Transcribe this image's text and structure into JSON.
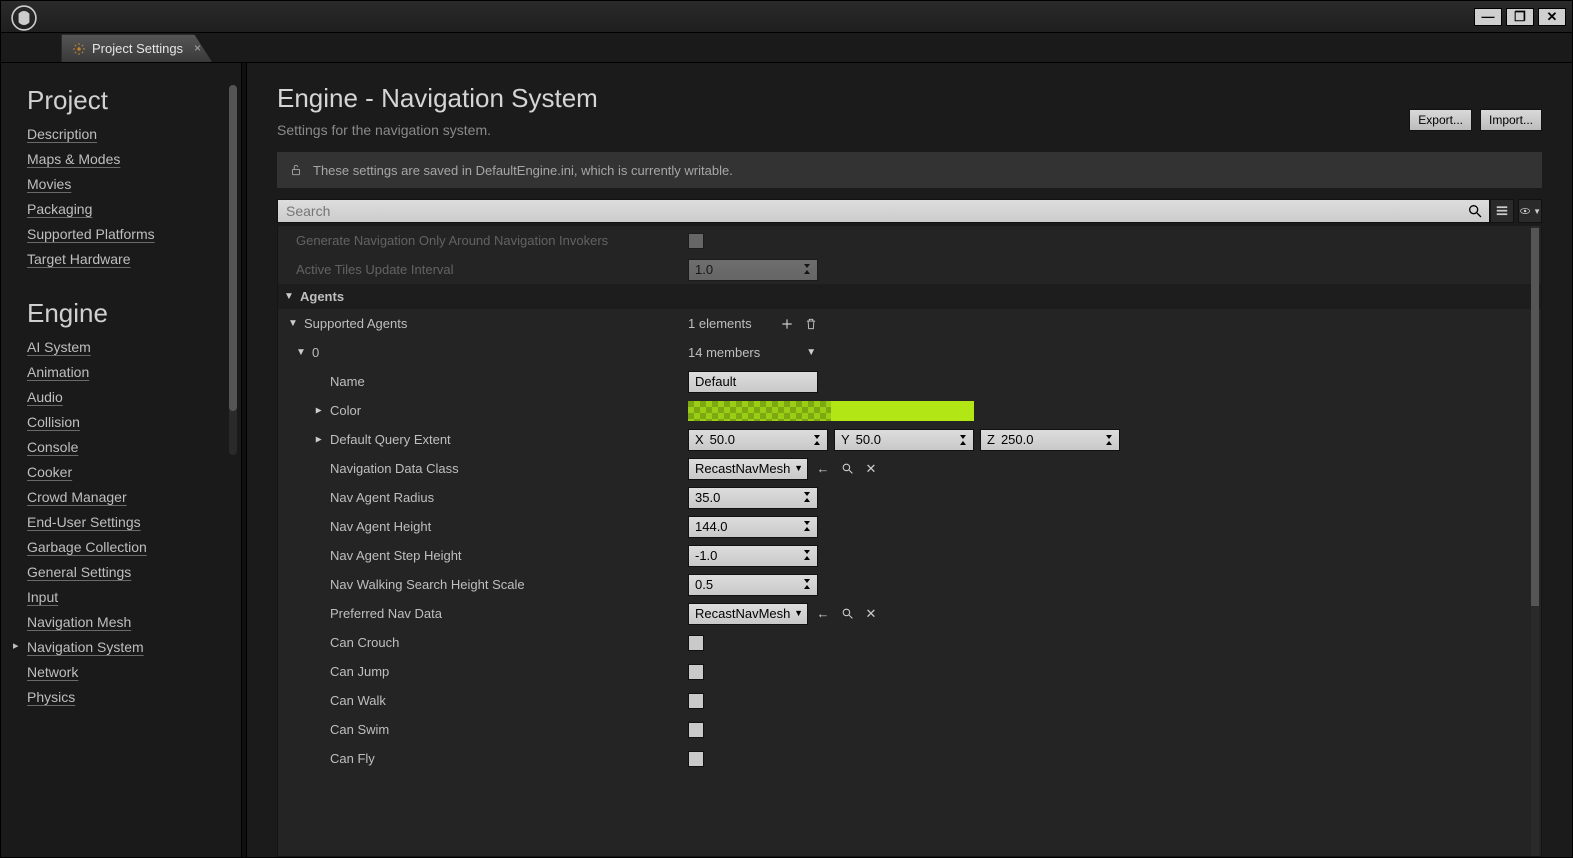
{
  "tab": {
    "title": "Project Settings",
    "close": "×"
  },
  "win": {
    "min": "—",
    "max": "❐",
    "close": "✕"
  },
  "sidebar": {
    "sections": [
      {
        "title": "Project",
        "items": [
          "Description",
          "Maps & Modes",
          "Movies",
          "Packaging",
          "Supported Platforms",
          "Target Hardware"
        ]
      },
      {
        "title": "Engine",
        "items": [
          "AI System",
          "Animation",
          "Audio",
          "Collision",
          "Console",
          "Cooker",
          "Crowd Manager",
          "End-User Settings",
          "Garbage Collection",
          "General Settings",
          "Input",
          "Navigation Mesh",
          "Navigation System",
          "Network",
          "Physics"
        ]
      }
    ],
    "selected": "Navigation System"
  },
  "page": {
    "title": "Engine - Navigation System",
    "subtitle": "Settings for the navigation system.",
    "export": "Export...",
    "import": "Import..."
  },
  "banner": "These settings are saved in DefaultEngine.ini, which is currently writable.",
  "search": {
    "placeholder": "Search"
  },
  "props": {
    "partial_rows": {
      "gen_nav_label": "Generate Navigation Only Around Navigation Invokers",
      "tiles_label": "Active Tiles Update Interval",
      "tiles_value": "1.0"
    },
    "agents_header": "Agents",
    "supported_agents": {
      "label": "Supported Agents",
      "elements": "1 elements",
      "item0": {
        "index_label": "0",
        "members": "14 members",
        "name_label": "Name",
        "name_value": "Default",
        "color_label": "Color",
        "color_value": "#B2E614",
        "ext_label": "Default Query Extent",
        "ext_x_label": "X",
        "ext_x": "50.0",
        "ext_y_label": "Y",
        "ext_y": "50.0",
        "ext_z_label": "Z",
        "ext_z": "250.0",
        "nav_class_label": "Navigation Data Class",
        "nav_class_value": "RecastNavMesh",
        "radius_label": "Nav Agent Radius",
        "radius_value": "35.0",
        "height_label": "Nav Agent Height",
        "height_value": "144.0",
        "step_label": "Nav Agent Step Height",
        "step_value": "-1.0",
        "walk_scale_label": "Nav Walking Search Height Scale",
        "walk_scale_value": "0.5",
        "pref_label": "Preferred Nav Data",
        "pref_value": "RecastNavMesh",
        "can_crouch": "Can Crouch",
        "can_jump": "Can Jump",
        "can_walk": "Can Walk",
        "can_swim": "Can Swim",
        "can_fly": "Can Fly"
      }
    }
  }
}
